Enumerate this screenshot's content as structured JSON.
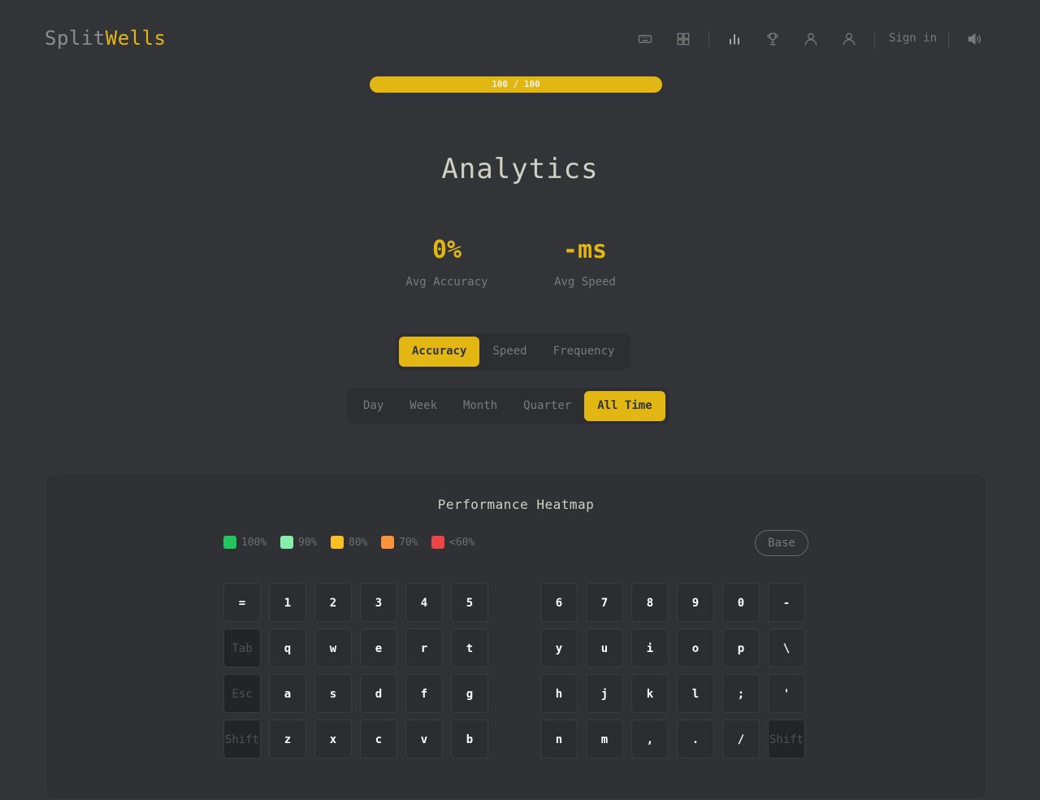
{
  "brand": {
    "part1": "Split",
    "part2": "Wells"
  },
  "nav": {
    "icons": [
      "keyboard-icon",
      "grid-icon",
      "bar-chart-icon",
      "trophy-icon",
      "user-icon",
      "user-icon"
    ],
    "signin": "Sign in",
    "sound_icon": "speaker-icon"
  },
  "progress": {
    "label": "100 / 100",
    "value": 100,
    "max": 100
  },
  "page": {
    "title": "Analytics"
  },
  "stats": [
    {
      "value": "0%",
      "label": "Avg Accuracy"
    },
    {
      "value": "-ms",
      "label": "Avg Speed"
    }
  ],
  "metric_tabs": {
    "items": [
      "Accuracy",
      "Speed",
      "Frequency"
    ],
    "selected": "Accuracy"
  },
  "range_tabs": {
    "items": [
      "Day",
      "Week",
      "Month",
      "Quarter",
      "All Time"
    ],
    "selected": "All Time"
  },
  "heatmap": {
    "title": "Performance Heatmap",
    "legend": [
      {
        "label": "100%",
        "color": "#22c55e"
      },
      {
        "label": "90%",
        "color": "#86efac"
      },
      {
        "label": "80%",
        "color": "#fbbf24"
      },
      {
        "label": "70%",
        "color": "#fb923c"
      },
      {
        "label": "<60%",
        "color": "#ef4444"
      }
    ],
    "base_button": "Base",
    "left_rows": [
      [
        "=",
        "1",
        "2",
        "3",
        "4",
        "5"
      ],
      [
        "Tab",
        "q",
        "w",
        "e",
        "r",
        "t"
      ],
      [
        "Esc",
        "a",
        "s",
        "d",
        "f",
        "g"
      ],
      [
        "Shift",
        "z",
        "x",
        "c",
        "v",
        "b"
      ]
    ],
    "right_rows": [
      [
        "6",
        "7",
        "8",
        "9",
        "0",
        "-"
      ],
      [
        "y",
        "u",
        "i",
        "o",
        "p",
        "\\"
      ],
      [
        "h",
        "j",
        "k",
        "l",
        ";",
        "'"
      ],
      [
        "n",
        "m",
        ",",
        ".",
        "/",
        "Shift"
      ]
    ],
    "modifier_keys": [
      "Tab",
      "Esc",
      "Shift"
    ]
  }
}
